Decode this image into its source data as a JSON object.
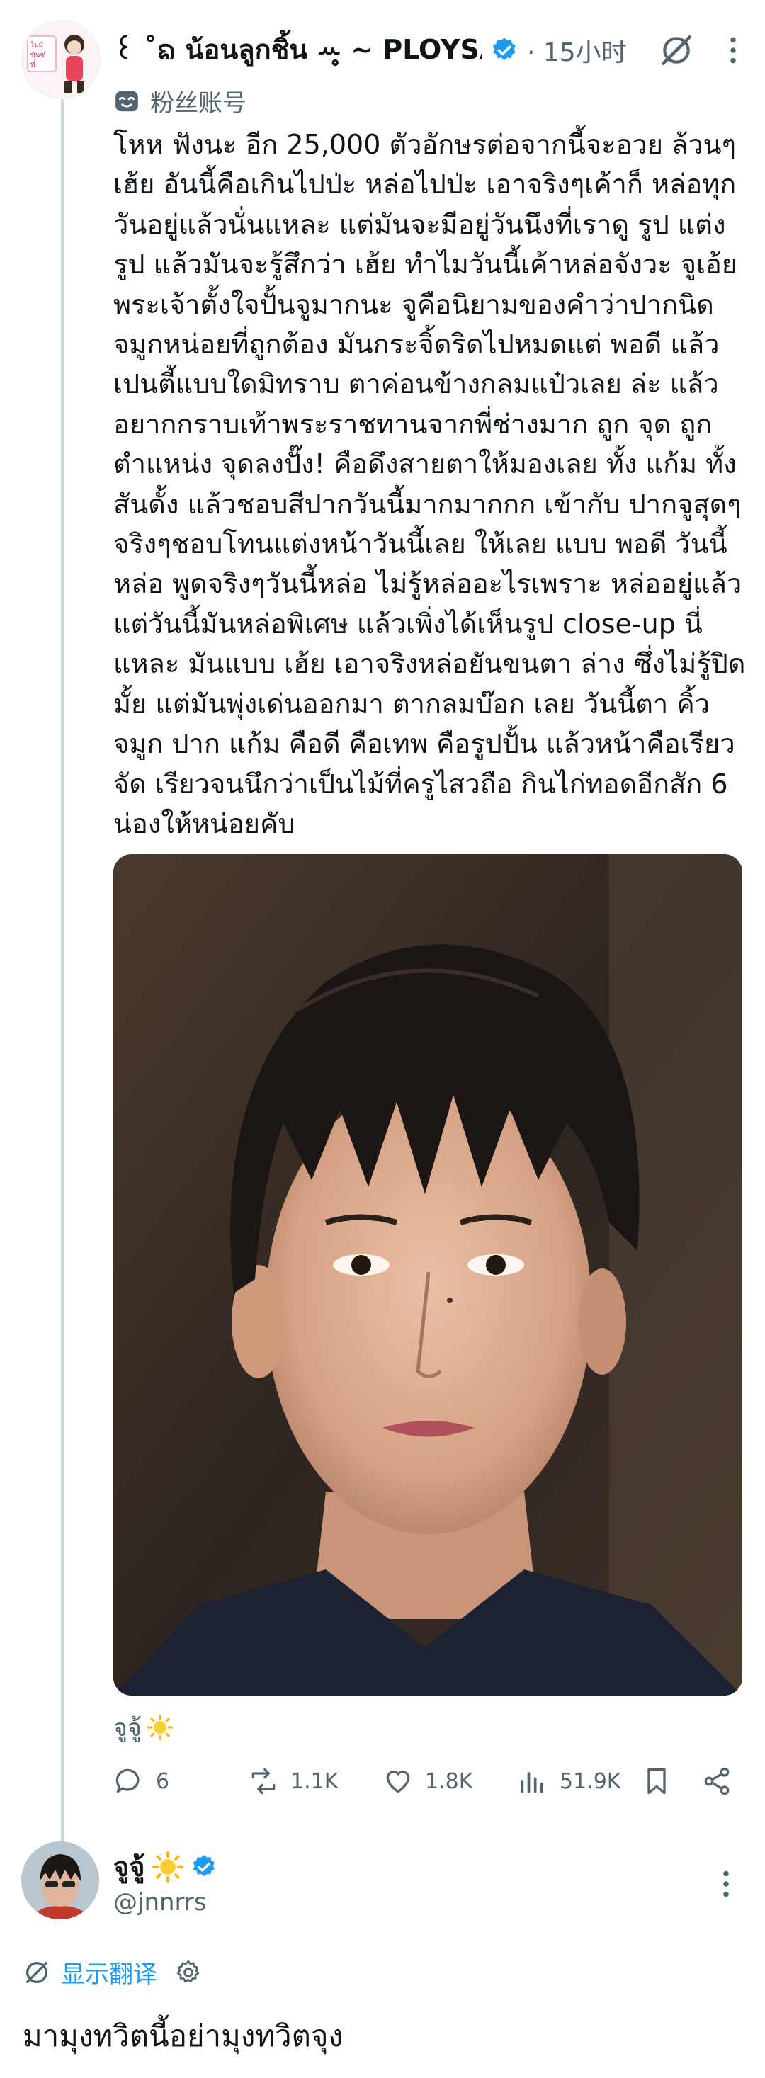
{
  "post": {
    "display_name": "꒰ ˚ᨦ น้อนลูกชิ้น ꕀ̥̥ ~ PLOYSA...",
    "time": "· 15小时",
    "account_type": "粉丝账号",
    "text": "โหห ฟังนะ อีก 25,000 ตัวอักษรต่อจากนี้จะอวย ล้วนๆ เฮ้ย อันนี้คือเกินไปป่ะ หล่อไปป่ะ เอาจริงๆเค้าก็ หล่อทุกวันอยู่แล้วนั่นแหละ แต่มันจะมีอยู่วันนึงที่เราดู รูป แต่งรูป แล้วมันจะรู้สึกว่า เฮ้ย ทำไมวันนี้เค้าหล่อจังวะ จูเอ้ย พระเจ้าตั้งใจปั้นจูมากนะ จูคือนิยามของคำว่าปากนิด จมูกหน่อยที่ถูกต้อง มันกระจิ้ดริดไปหมดแต่ พอดี แล้วเปนตี้แบบใดมิทราบ ตาค่อนข้างกลมแป๋วเลย ล่ะ แล้วอยากกราบเท้าพระราชทานจากพี่ช่างมาก ถูก จุด ถูกตำแหน่ง จุดลงปั๊ง! คือดึงสายตาให้มองเลย ทั้ง แก้ม ทั้งสันดั้ง แล้วชอบสีปากวันนี้มากมากกก เข้ากับ ปากจูสุดๆ จริงๆชอบโทนแต่งหน้าวันนี้เลย ให้เลย แบบ พอดี วันนี้หล่อ พูดจริงๆวันนี้หล่อ ไม่รู้หล่ออะไรเพราะ หล่ออยู่แล้ว แต่วันนี้มันหล่อพิเศษ แล้วเพิ่งได้เห็นรูป close-up นี่แหละ มันแบบ เฮ้ย เอาจริงหล่อยันขนตา ล่าง ซึ่งไม่รู้ปิดมั้ย แต่มันพุ่งเด่นออกมา ตากลมบ๊อก เลย วันนี้ตา คิ้ว จมูก ปาก แก้ม คือดี คือเทพ คือรูปปั้น แล้วหน้าคือเรียวจัด เรียวจนนึกว่าเป็นไม้ที่ครูไสวถือ กินไก่ทอดอีกสัก 6 น่องให้หน่อยคับ",
    "caption": "จูจู้",
    "stats": {
      "replies": "6",
      "retweets": "1.1K",
      "likes": "1.8K",
      "views": "51.9K"
    }
  },
  "reply": {
    "display_name": "จูจู้",
    "handle": "@jnnrrs",
    "translate_label": "显示翻译",
    "text": "มามุงทวิตนี้อย่ามุงทวิตจุง"
  },
  "colors": {
    "accent": "#1d9bf0",
    "secondary_text": "#536471",
    "thread_line": "#cfd9de"
  },
  "icons": [
    "verified-badge-icon",
    "grok-icon",
    "more-icon",
    "fan-mask-icon",
    "reply-icon",
    "retweet-icon",
    "like-icon",
    "views-icon",
    "bookmark-icon",
    "share-icon",
    "translate-icon",
    "settings-gear-icon",
    "sun-emoji-icon"
  ]
}
